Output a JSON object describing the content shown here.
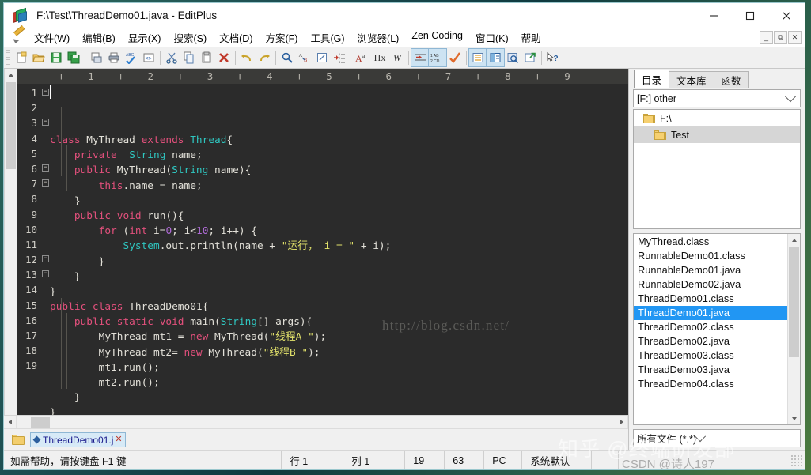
{
  "window": {
    "title": "F:\\Test\\ThreadDemo01.java - EditPlus",
    "icon": "editplus-books-icon",
    "minimize": "–",
    "maximize": "☐",
    "close": "✕"
  },
  "menu": {
    "pencil_icon": "pencil-icon",
    "items": [
      "文件(W)",
      "编辑(B)",
      "显示(X)",
      "搜索(S)",
      "文档(D)",
      "方案(F)",
      "工具(G)",
      "浏览器(L)",
      "Zen Coding",
      "窗口(K)",
      "帮助"
    ],
    "mdi_buttons": [
      "–",
      "❐",
      "✕"
    ]
  },
  "toolbar": {
    "groups": [
      [
        "new-file-icon",
        "open-file-icon",
        "save-icon",
        "save-all-icon"
      ],
      [
        "print-preview-icon",
        "print-icon",
        "spellcheck-abc-icon",
        "html-tag-icon"
      ],
      [
        "cut-icon",
        "copy-icon",
        "paste-icon",
        "delete-x-icon"
      ],
      [
        "undo-icon",
        "redo-icon"
      ],
      [
        "find-icon",
        "replace-icon",
        "goto-icon",
        "line-number-icon"
      ],
      [
        "font-icon",
        "hex-icon",
        "word-wrap-icon"
      ],
      [
        "indent-icon",
        "wrap-lines-icon",
        "check-icon"
      ],
      [
        "list-view-icon",
        "split-view-icon",
        "browser-preview-icon",
        "external-browser-icon"
      ],
      [
        "context-help-icon"
      ]
    ],
    "hex_label": "Hx",
    "word_label": "W",
    "font_label": "A",
    "wrap_label": "1 AB\n2 CD"
  },
  "editor": {
    "ruler": "---+----1----+----2----+----3----+----4----+----5----+----6----+----7----+----8----+----9",
    "caret_line": 1,
    "watermark": "http://blog.csdn.net/",
    "lines": [
      {
        "n": 1,
        "fold": "−",
        "tokens": [
          {
            "t": "class ",
            "c": "kw"
          },
          {
            "t": "MyThread ",
            "c": "pl"
          },
          {
            "t": "extends ",
            "c": "kw"
          },
          {
            "t": "Thread",
            "c": "ty"
          },
          {
            "t": "{",
            "c": "pl"
          }
        ]
      },
      {
        "n": 2,
        "fold": "",
        "tokens": [
          {
            "t": "    ",
            "c": "pl"
          },
          {
            "t": "private ",
            "c": "kw"
          },
          {
            "t": " ",
            "c": "pl"
          },
          {
            "t": "String",
            "c": "ty"
          },
          {
            "t": " name;",
            "c": "pl"
          }
        ]
      },
      {
        "n": 3,
        "fold": "−",
        "tokens": [
          {
            "t": "    ",
            "c": "pl"
          },
          {
            "t": "public ",
            "c": "kw"
          },
          {
            "t": "MyThread(",
            "c": "pl"
          },
          {
            "t": "String",
            "c": "ty"
          },
          {
            "t": " name){",
            "c": "pl"
          }
        ]
      },
      {
        "n": 4,
        "fold": "",
        "tokens": [
          {
            "t": "        ",
            "c": "pl"
          },
          {
            "t": "this",
            "c": "kw"
          },
          {
            "t": ".name = name;",
            "c": "pl"
          }
        ]
      },
      {
        "n": 5,
        "fold": "",
        "tokens": [
          {
            "t": "    }",
            "c": "pl"
          }
        ]
      },
      {
        "n": 6,
        "fold": "−",
        "tokens": [
          {
            "t": "    ",
            "c": "pl"
          },
          {
            "t": "public void ",
            "c": "kw"
          },
          {
            "t": "run(){",
            "c": "pl"
          }
        ]
      },
      {
        "n": 7,
        "fold": "−",
        "tokens": [
          {
            "t": "        ",
            "c": "pl"
          },
          {
            "t": "for ",
            "c": "kw"
          },
          {
            "t": "(",
            "c": "pl"
          },
          {
            "t": "int",
            "c": "kw"
          },
          {
            "t": " i=",
            "c": "pl"
          },
          {
            "t": "0",
            "c": "nm"
          },
          {
            "t": "; i<",
            "c": "pl"
          },
          {
            "t": "10",
            "c": "nm"
          },
          {
            "t": "; i++) {",
            "c": "pl"
          }
        ]
      },
      {
        "n": 8,
        "fold": "",
        "tokens": [
          {
            "t": "            ",
            "c": "pl"
          },
          {
            "t": "System",
            "c": "ty"
          },
          {
            "t": ".out.println(name + ",
            "c": "pl"
          },
          {
            "t": "\"运行， i = \"",
            "c": "st"
          },
          {
            "t": " + i);",
            "c": "pl"
          }
        ]
      },
      {
        "n": 9,
        "fold": "",
        "tokens": [
          {
            "t": "        }",
            "c": "pl"
          }
        ]
      },
      {
        "n": 10,
        "fold": "",
        "tokens": [
          {
            "t": "    }",
            "c": "pl"
          }
        ]
      },
      {
        "n": 11,
        "fold": "",
        "tokens": [
          {
            "t": "}",
            "c": "pl"
          }
        ]
      },
      {
        "n": 12,
        "fold": "−",
        "tokens": [
          {
            "t": "public class ",
            "c": "kw"
          },
          {
            "t": "ThreadDemo01{",
            "c": "pl"
          }
        ]
      },
      {
        "n": 13,
        "fold": "−",
        "tokens": [
          {
            "t": "    ",
            "c": "pl"
          },
          {
            "t": "public static void ",
            "c": "kw"
          },
          {
            "t": "main(",
            "c": "pl"
          },
          {
            "t": "String",
            "c": "ty"
          },
          {
            "t": "[] args){",
            "c": "pl"
          }
        ]
      },
      {
        "n": 14,
        "fold": "",
        "tokens": [
          {
            "t": "        MyThread mt1 = ",
            "c": "pl"
          },
          {
            "t": "new ",
            "c": "kw"
          },
          {
            "t": "MyThread(",
            "c": "pl"
          },
          {
            "t": "\"线程A \"",
            "c": "st"
          },
          {
            "t": ");",
            "c": "pl"
          }
        ]
      },
      {
        "n": 15,
        "fold": "",
        "tokens": [
          {
            "t": "        MyThread mt2= ",
            "c": "pl"
          },
          {
            "t": "new ",
            "c": "kw"
          },
          {
            "t": "MyThread(",
            "c": "pl"
          },
          {
            "t": "\"线程B \"",
            "c": "st"
          },
          {
            "t": ");",
            "c": "pl"
          }
        ]
      },
      {
        "n": 16,
        "fold": "",
        "tokens": [
          {
            "t": "        mt1.run();",
            "c": "pl"
          }
        ]
      },
      {
        "n": 17,
        "fold": "",
        "tokens": [
          {
            "t": "        mt2.run();",
            "c": "pl"
          }
        ]
      },
      {
        "n": 18,
        "fold": "",
        "tokens": [
          {
            "t": "    }",
            "c": "pl"
          }
        ]
      },
      {
        "n": 19,
        "fold": "",
        "tokens": [
          {
            "t": "}",
            "c": "pl"
          }
        ]
      }
    ],
    "colors": {
      "background": "#2b2b2b",
      "keyword": "#e2507c",
      "type": "#2fc6c0",
      "string": "#e3e36b",
      "number": "#b06bd8",
      "plain": "#e2e0d8",
      "gutter_text": "#cfcdc6",
      "ruler_bg": "#3a3a38"
    }
  },
  "doc_tabs": {
    "folder_icon": "folder-icon",
    "tabs": [
      {
        "label": "ThreadDemo01.j",
        "close": "✕",
        "active": true
      }
    ]
  },
  "right_panel": {
    "tabs": [
      {
        "label": "目录",
        "selected": true
      },
      {
        "label": "文本库",
        "selected": false
      },
      {
        "label": "函数",
        "selected": false
      }
    ],
    "drive_combo": {
      "value": "[F:] other",
      "icon": "chevron-down-icon"
    },
    "tree": [
      {
        "label": "F:\\",
        "level": 1,
        "selected": false,
        "icon": "folder-icon"
      },
      {
        "label": "Test",
        "level": 2,
        "selected": true,
        "icon": "folder-open-icon"
      }
    ],
    "files": [
      {
        "name": "MyThread.class",
        "selected": false
      },
      {
        "name": "RunnableDemo01.class",
        "selected": false
      },
      {
        "name": "RunnableDemo01.java",
        "selected": false
      },
      {
        "name": "RunnableDemo02.java",
        "selected": false
      },
      {
        "name": "ThreadDemo01.class",
        "selected": false
      },
      {
        "name": "ThreadDemo01.java",
        "selected": true
      },
      {
        "name": "ThreadDemo02.class",
        "selected": false
      },
      {
        "name": "ThreadDemo02.java",
        "selected": false
      },
      {
        "name": "ThreadDemo03.class",
        "selected": false
      },
      {
        "name": "ThreadDemo03.java",
        "selected": false
      },
      {
        "name": "ThreadDemo04.class",
        "selected": false
      }
    ],
    "filter_combo": {
      "value": "所有文件 (*.*)",
      "icon": "chevron-down-icon"
    },
    "selection_color": "#2196f3"
  },
  "status_bar": {
    "hint": "如需帮助，请按键盘 F1 键",
    "cells": [
      "行 1",
      "列 1",
      "19",
      "63",
      "PC",
      "系统默认",
      "",
      ""
    ]
  },
  "overlay_watermarks": {
    "zhihu": "知乎 @终端研发部",
    "csdn": "CSDN @诗人197"
  }
}
